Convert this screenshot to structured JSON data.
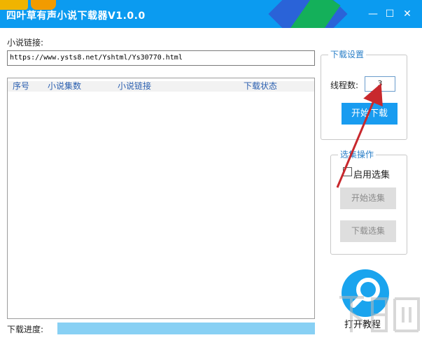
{
  "window": {
    "title": "四叶草有声小说下载器V1.0.0",
    "minimize": "—",
    "maximize": "☐",
    "close": "✕"
  },
  "url_section": {
    "label": "小说链接:",
    "value": "https://www.ysts8.net/Yshtml/Ys30770.html"
  },
  "list": {
    "columns": [
      "序号",
      "小说集数",
      "小说链接",
      "下载状态"
    ],
    "rows": []
  },
  "progress": {
    "label": "下载进度:",
    "value_fraction": 1.0
  },
  "download_settings": {
    "title": "下载设置",
    "threads_label": "线程数:",
    "threads_value": "3",
    "start_button": "开始下载"
  },
  "selection": {
    "title": "选集操作",
    "enable_label": "启用选集",
    "enable_checked": false,
    "start_button": "开始选集",
    "download_button": "下载选集"
  },
  "tutorial": {
    "label": "打开教程",
    "icon": "search-icon"
  },
  "colors": {
    "titlebar": "#0b9bf0",
    "primary": "#199cf0",
    "arrow": "#c8282d",
    "progress": "#88d0f4"
  }
}
